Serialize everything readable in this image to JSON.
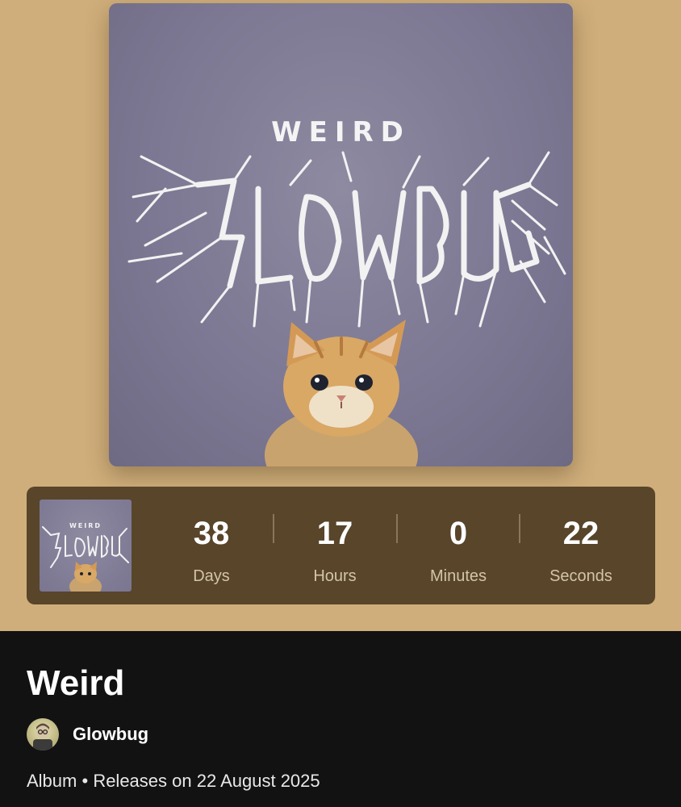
{
  "album": {
    "cover_word": "WEIRD",
    "title": "Weird",
    "artist": "Glowbug",
    "type": "Album",
    "separator": "•",
    "release_text": "Releases on 22 August 2025"
  },
  "countdown": {
    "days": {
      "value": "38",
      "label": "Days"
    },
    "hours": {
      "value": "17",
      "label": "Hours"
    },
    "minutes": {
      "value": "0",
      "label": "Minutes"
    },
    "seconds": {
      "value": "22",
      "label": "Seconds"
    }
  },
  "colors": {
    "hero_background": "#cfae7b",
    "countdown_background": "#58452a",
    "page_background": "#121212"
  },
  "icons": {
    "cover_logo": "glowbug-metal-logo",
    "cover_subject": "kitten"
  }
}
